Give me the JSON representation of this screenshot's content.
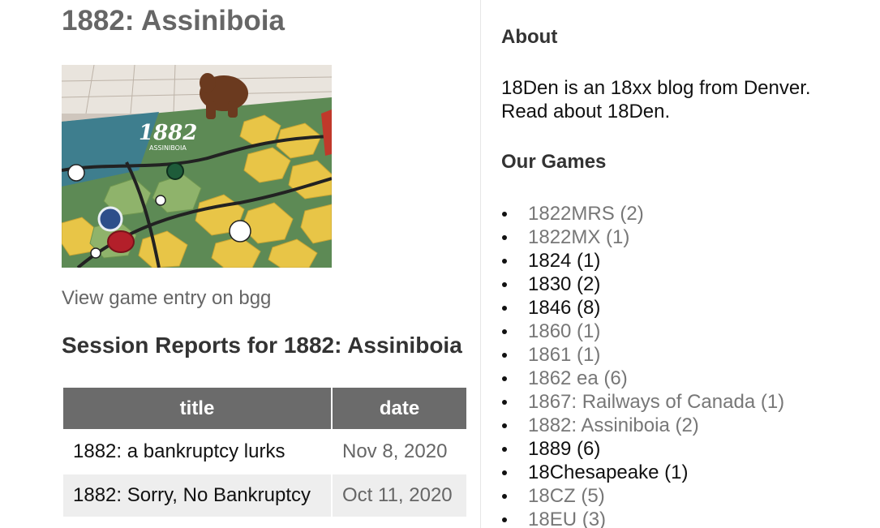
{
  "page": {
    "title": "1882: Assiniboia",
    "image_alt": "1882 Assiniboia game board with wooden bear piece",
    "bgg_link_label": "View game entry on bgg",
    "reports_heading": "Session Reports for 1882: Assiniboia"
  },
  "reports": {
    "headers": {
      "title": "title",
      "date": "date"
    },
    "rows": [
      {
        "title": "1882: a bankruptcy lurks",
        "date": "Nov 8, 2020"
      },
      {
        "title": "1882: Sorry, No Bankruptcy",
        "date": "Oct 11, 2020"
      }
    ]
  },
  "sidebar": {
    "about_heading": "About",
    "about_text": "18Den is an 18xx blog from Denver.",
    "about_link": "Read about 18Den.",
    "games_heading": "Our Games",
    "games": [
      {
        "label": "1822MRS (2)",
        "visited": true
      },
      {
        "label": "1822MX (1)",
        "visited": true
      },
      {
        "label": "1824 (1)",
        "visited": false
      },
      {
        "label": "1830 (2)",
        "visited": false
      },
      {
        "label": "1846 (8)",
        "visited": false
      },
      {
        "label": "1860 (1)",
        "visited": true
      },
      {
        "label": "1861 (1)",
        "visited": true
      },
      {
        "label": "1862 ea (6)",
        "visited": true
      },
      {
        "label": "1867: Railways of Canada (1)",
        "visited": true
      },
      {
        "label": "1882: Assiniboia (2)",
        "visited": true
      },
      {
        "label": "1889 (6)",
        "visited": false
      },
      {
        "label": "18Chesapeake (1)",
        "visited": false
      },
      {
        "label": "18CZ (5)",
        "visited": true
      },
      {
        "label": "18EU (3)",
        "visited": true
      }
    ]
  },
  "colors": {
    "title_gray": "#666666",
    "table_header_bg": "#6b6b6b",
    "table_alt_row": "#eeeeee",
    "visited_link": "#777777",
    "link": "#111111"
  }
}
